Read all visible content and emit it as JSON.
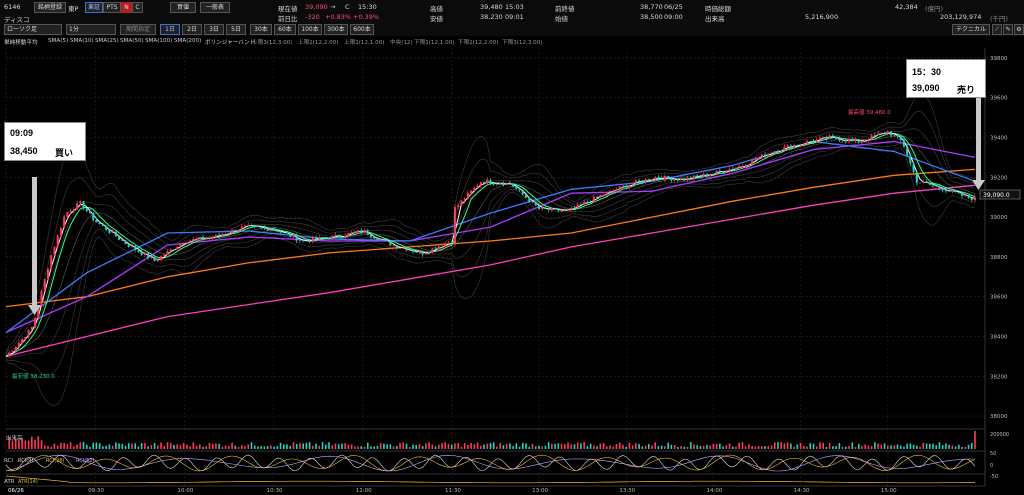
{
  "header": {
    "code": "6146",
    "name": "ディスコ",
    "market_label": "東P",
    "buttons": [
      "銘柄登録",
      "東証",
      "PTS",
      "N",
      "C"
    ],
    "trade_buttons": [
      "買値",
      "一般表"
    ],
    "current_label": "現在値",
    "current_value": "39,090",
    "current_arrow": "→",
    "current_flag": "C",
    "current_time": "15:30",
    "change_label": "前日比",
    "change_value": "-320",
    "change_pct1": "+0.83%",
    "change_pct2": "+0.39%",
    "high_label": "高値",
    "high_value": "39,480",
    "high_time": "15:03",
    "low_label": "安値",
    "low_value": "38,230",
    "low_time": "09:01",
    "prev_label": "前終値",
    "prev_value": "38,770",
    "prev_date": "06/25",
    "open_label": "始値",
    "open_value": "38,500",
    "open_time": "09:00",
    "mcap_label": "時価総額",
    "mcap_value": "42,384",
    "mcap_unit": "(億円)",
    "volume_label": "出来高",
    "volume_value": "5,216,900",
    "turnover_value": "203,129,974",
    "turnover_unit": "(千円)"
  },
  "toolbar": {
    "chart_type": "ローソク足",
    "interval": "1分",
    "range_buttons": [
      "1日",
      "2日",
      "3日",
      "5日"
    ],
    "bar_buttons": [
      "30本",
      "60本",
      "100本",
      "300本",
      "600本"
    ],
    "period_select": "期間指定",
    "technical_button": "テクニカル"
  },
  "ma_legend": {
    "title": "単純移動平均",
    "items": [
      {
        "label": "SMA(5)",
        "color": "#ffffff"
      },
      {
        "label": "SMA(10)",
        "color": "#33ff88"
      },
      {
        "label": "SMA(25)",
        "color": "#3d7bff"
      },
      {
        "label": "SMA(50)",
        "color": "#a93cff"
      },
      {
        "label": "SMA(100)",
        "color": "#ff7a1a"
      },
      {
        "label": "SMA(200)",
        "color": "#ff3fbf"
      }
    ],
    "bb_title": "ボリンジャーバンド",
    "bb_items": [
      "上限3(12,3.00)",
      "上限2(12,2.00)",
      "上限1(12,1.00)",
      "中央(12)",
      "下限1(12,1.00)",
      "下限2(12,2.00)",
      "下限3(12,3.00)"
    ]
  },
  "callouts": {
    "buy_time": "09:09",
    "buy_price": "38,450",
    "buy_action": "買い",
    "sell_time": "15：30",
    "sell_price": "39,090",
    "sell_action": "売り"
  },
  "annotations": {
    "high_marker": "最高値 39,480.0",
    "low_marker": "最安値 38,230.0",
    "last_price_tag": "39,090.0"
  },
  "panels": {
    "volume_label": "出来高",
    "rci_label": "RCI",
    "rci_items": [
      "RCI(9)",
      "RCI(26)",
      "RCI(52)"
    ],
    "atr_label": "ATR",
    "atr_items": [
      "ATR(14)"
    ],
    "rci_ticks": [
      "50",
      "0",
      "-50"
    ],
    "volume_tick": "200000"
  },
  "chart_data": {
    "type": "candlestick",
    "title": "",
    "x_labels": [
      "06/26",
      "09:30",
      "10:00",
      "10:30",
      "11:00",
      "11:30",
      "13:00",
      "13:30",
      "14:00",
      "14:30",
      "15:00"
    ],
    "y_ticks": [
      38000,
      38200,
      38400,
      38600,
      38800,
      39000,
      39200,
      39400,
      39600,
      39800
    ],
    "ylim": [
      37950,
      39850
    ],
    "grid": true,
    "close_path": [
      [
        "09:00",
        38300
      ],
      [
        "09:05",
        38380
      ],
      [
        "09:09",
        38450
      ],
      [
        "09:15",
        38800
      ],
      [
        "09:20",
        39020
      ],
      [
        "09:25",
        39070
      ],
      [
        "09:30",
        38980
      ],
      [
        "09:40",
        38870
      ],
      [
        "09:50",
        38780
      ],
      [
        "10:00",
        38880
      ],
      [
        "10:10",
        38900
      ],
      [
        "10:20",
        38950
      ],
      [
        "10:30",
        38940
      ],
      [
        "10:40",
        38880
      ],
      [
        "10:50",
        38900
      ],
      [
        "11:00",
        38930
      ],
      [
        "11:10",
        38860
      ],
      [
        "11:20",
        38820
      ],
      [
        "11:30",
        38880
      ],
      [
        "12:30",
        39030
      ],
      [
        "12:40",
        39180
      ],
      [
        "12:50",
        39170
      ],
      [
        "13:00",
        39040
      ],
      [
        "13:10",
        39030
      ],
      [
        "13:20",
        39100
      ],
      [
        "13:30",
        39160
      ],
      [
        "13:40",
        39200
      ],
      [
        "13:50",
        39190
      ],
      [
        "14:00",
        39220
      ],
      [
        "14:10",
        39260
      ],
      [
        "14:20",
        39330
      ],
      [
        "14:30",
        39370
      ],
      [
        "14:40",
        39400
      ],
      [
        "14:50",
        39380
      ],
      [
        "15:00",
        39430
      ],
      [
        "15:05",
        39380
      ],
      [
        "15:10",
        39180
      ],
      [
        "15:20",
        39140
      ],
      [
        "15:25",
        39110
      ],
      [
        "15:30",
        39090
      ]
    ],
    "series": [
      {
        "name": "SMA(100)",
        "color": "#ff7a1a",
        "values": [
          38550,
          38600,
          38700,
          38770,
          38820,
          38850,
          38880,
          38920,
          39000,
          39080,
          39150,
          39210,
          39240
        ]
      },
      {
        "name": "SMA(200)",
        "color": "#ff3fbf",
        "values": [
          38300,
          38400,
          38500,
          38560,
          38620,
          38690,
          38760,
          38850,
          38920,
          38990,
          39060,
          39120,
          39160
        ]
      },
      {
        "name": "SMA(50)",
        "color": "#a93cff",
        "values": [
          38420,
          38600,
          38860,
          38900,
          38880,
          38880,
          38950,
          39120,
          39130,
          39220,
          39340,
          39380,
          39300
        ]
      },
      {
        "name": "SMA(25)",
        "color": "#3d7bff",
        "values": [
          38420,
          38720,
          38920,
          38930,
          38890,
          38880,
          39020,
          39140,
          39180,
          39260,
          39380,
          39330,
          39180
        ]
      }
    ],
    "annotations": {
      "high": 39480,
      "low": 38230,
      "buy": 38450,
      "sell": 39090
    }
  }
}
